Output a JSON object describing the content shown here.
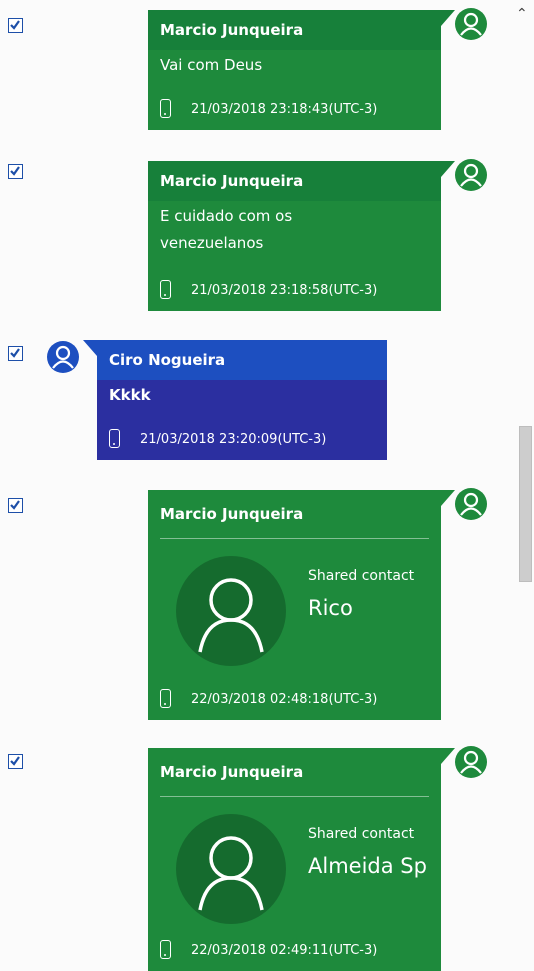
{
  "chat": {
    "messages": [
      {
        "sender": "Marcio Junqueira",
        "text": "Vai com Deus",
        "timestamp": "21/03/2018 23:18:43(UTC-3)",
        "selected": true
      },
      {
        "sender": "Marcio Junqueira",
        "text_lines": [
          "E cuidado com os",
          "venezuelanos"
        ],
        "timestamp": "21/03/2018 23:18:58(UTC-3)",
        "selected": true
      },
      {
        "sender": "Ciro Nogueira",
        "text": "Kkkk",
        "timestamp": "21/03/2018 23:20:09(UTC-3)",
        "selected": true
      },
      {
        "sender": "Marcio Junqueira",
        "shared_contact_label": "Shared contact",
        "shared_contact_name": "Rico",
        "timestamp": "22/03/2018 02:48:18(UTC-3)",
        "selected": true
      },
      {
        "sender": "Marcio Junqueira",
        "shared_contact_label": "Shared contact",
        "shared_contact_name": "Almeida Sp",
        "timestamp": "22/03/2018 02:49:11(UTC-3)",
        "selected": true
      }
    ]
  },
  "icons": {
    "checkbox": "checkmark-icon",
    "avatar": "user-avatar-icon",
    "device": "phone-icon",
    "scroll_up": "chevron-up-icon"
  },
  "colors": {
    "outgoing_bubble": "#1e8a3c",
    "outgoing_header": "#17803a",
    "incoming_bubble": "#2b2fa0",
    "incoming_header": "#1d4fc0",
    "checkbox_border": "#1d4fa8"
  }
}
